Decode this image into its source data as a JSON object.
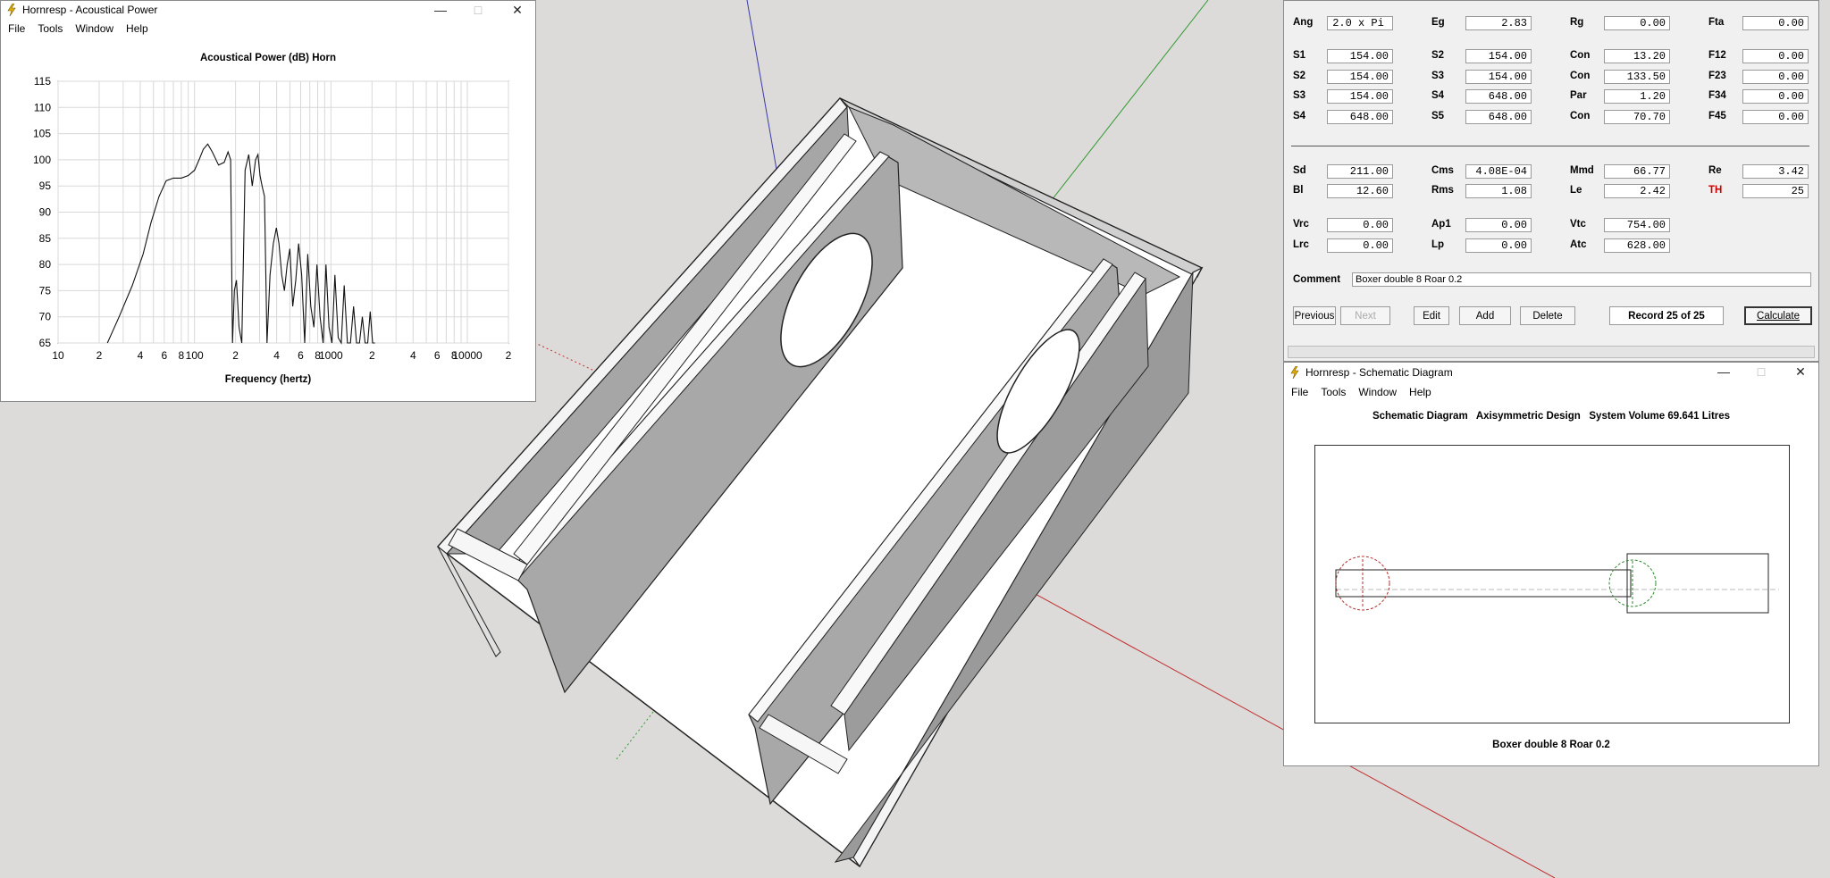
{
  "acoustic_window": {
    "title": "Hornresp - Acoustical Power",
    "menu": [
      "File",
      "Tools",
      "Window",
      "Help"
    ],
    "chart_title": "Acoustical Power (dB)   Horn",
    "xlabel": "Frequency (hertz)"
  },
  "chart_data": {
    "type": "line",
    "title": "Acoustical Power (dB)   Horn",
    "xlabel": "Frequency (hertz)",
    "ylabel": "",
    "x_scale": "log",
    "xlim": [
      10,
      20000
    ],
    "ylim": [
      65,
      115
    ],
    "y_ticks": [
      "115",
      "110",
      "105",
      "100",
      "95",
      "90",
      "85",
      "80",
      "75",
      "70",
      "65"
    ],
    "x_ticks": [
      "10",
      "2",
      "4",
      "6",
      "8",
      "100",
      "2",
      "4",
      "6",
      "8",
      "1000",
      "2",
      "4",
      "6",
      "8",
      "10000",
      "2"
    ],
    "series": [
      {
        "x": [
          23,
          28,
          35,
          42,
          48,
          55,
          62,
          70,
          80,
          90,
          100,
          108,
          116,
          125,
          135,
          150,
          165,
          176,
          184,
          190,
          196,
          203,
          212,
          222,
          235,
          250,
          265,
          280,
          292,
          302,
          313,
          326,
          340,
          358,
          378,
          398,
          416,
          436,
          456,
          478,
          500,
          525,
          552,
          580,
          610,
          642,
          676,
          712,
          750,
          790,
          832,
          876,
          920,
          968,
          1018,
          1070,
          1130,
          1190,
          1250,
          1320,
          1390,
          1465,
          1540,
          1620,
          1700,
          1780,
          1860,
          1940,
          2020,
          2100
        ],
        "y": [
          65,
          70,
          76,
          82,
          88,
          93,
          96,
          96.5,
          96.5,
          97,
          98,
          100,
          102,
          103,
          101.5,
          99,
          99.5,
          101.5,
          100,
          65,
          75,
          77,
          68,
          65,
          98,
          101,
          95,
          100,
          101,
          97,
          95,
          93,
          65,
          78,
          84,
          87,
          84,
          78,
          75,
          80,
          83,
          72,
          77,
          84,
          78,
          65,
          82,
          72,
          68,
          80,
          70,
          65,
          80,
          68,
          65,
          78,
          66,
          65,
          76,
          65,
          65,
          72,
          65,
          65,
          70,
          65,
          65,
          71,
          65,
          65
        ]
      }
    ]
  },
  "params": {
    "row0": [
      {
        "label": "Ang",
        "value": "2.0 x Pi"
      },
      {
        "label": "Eg",
        "value": "2.83"
      },
      {
        "label": "Rg",
        "value": "0.00"
      },
      {
        "label": "Fta",
        "value": "0.00"
      }
    ],
    "rows": [
      [
        {
          "label": "S1",
          "value": "154.00"
        },
        {
          "label": "S2",
          "value": "154.00"
        },
        {
          "label": "Con",
          "value": "13.20"
        },
        {
          "label": "F12",
          "value": "0.00"
        }
      ],
      [
        {
          "label": "S2",
          "value": "154.00"
        },
        {
          "label": "S3",
          "value": "154.00"
        },
        {
          "label": "Con",
          "value": "133.50"
        },
        {
          "label": "F23",
          "value": "0.00"
        }
      ],
      [
        {
          "label": "S3",
          "value": "154.00"
        },
        {
          "label": "S4",
          "value": "648.00"
        },
        {
          "label": "Par",
          "value": "1.20"
        },
        {
          "label": "F34",
          "value": "0.00"
        }
      ],
      [
        {
          "label": "S4",
          "value": "648.00"
        },
        {
          "label": "S5",
          "value": "648.00"
        },
        {
          "label": "Con",
          "value": "70.70"
        },
        {
          "label": "F45",
          "value": "0.00"
        }
      ]
    ],
    "driver1": [
      {
        "label": "Sd",
        "value": "211.00"
      },
      {
        "label": "Cms",
        "value": "4.08E-04"
      },
      {
        "label": "Mmd",
        "value": "66.77"
      },
      {
        "label": "Re",
        "value": "3.42"
      }
    ],
    "driver2": [
      {
        "label": "Bl",
        "value": "12.60"
      },
      {
        "label": "Rms",
        "value": "1.08"
      },
      {
        "label": "Le",
        "value": "2.42"
      },
      {
        "label": "TH",
        "value": "25"
      }
    ],
    "chamber1": [
      {
        "label": "Vrc",
        "value": "0.00"
      },
      {
        "label": "Ap1",
        "value": "0.00"
      },
      {
        "label": "Vtc",
        "value": "754.00"
      }
    ],
    "chamber2": [
      {
        "label": "Lrc",
        "value": "0.00"
      },
      {
        "label": "Lp",
        "value": "0.00"
      },
      {
        "label": "Atc",
        "value": "628.00"
      }
    ],
    "comment_label": "Comment",
    "comment_value": "Boxer double 8 Roar 0.2",
    "buttons": {
      "previous": "Previous",
      "next": "Next",
      "edit": "Edit",
      "add": "Add",
      "delete": "Delete",
      "calculate": "Calculate"
    },
    "record": "Record 25 of 25",
    "th_color": "#cc0000"
  },
  "schematic_window": {
    "title": "Hornresp - Schematic Diagram",
    "menu": [
      "File",
      "Tools",
      "Window",
      "Help"
    ],
    "heading": "Schematic Diagram   Axisymmetric Design   System Volume 69.641 Litres",
    "caption": "Boxer double 8 Roar 0.2"
  }
}
